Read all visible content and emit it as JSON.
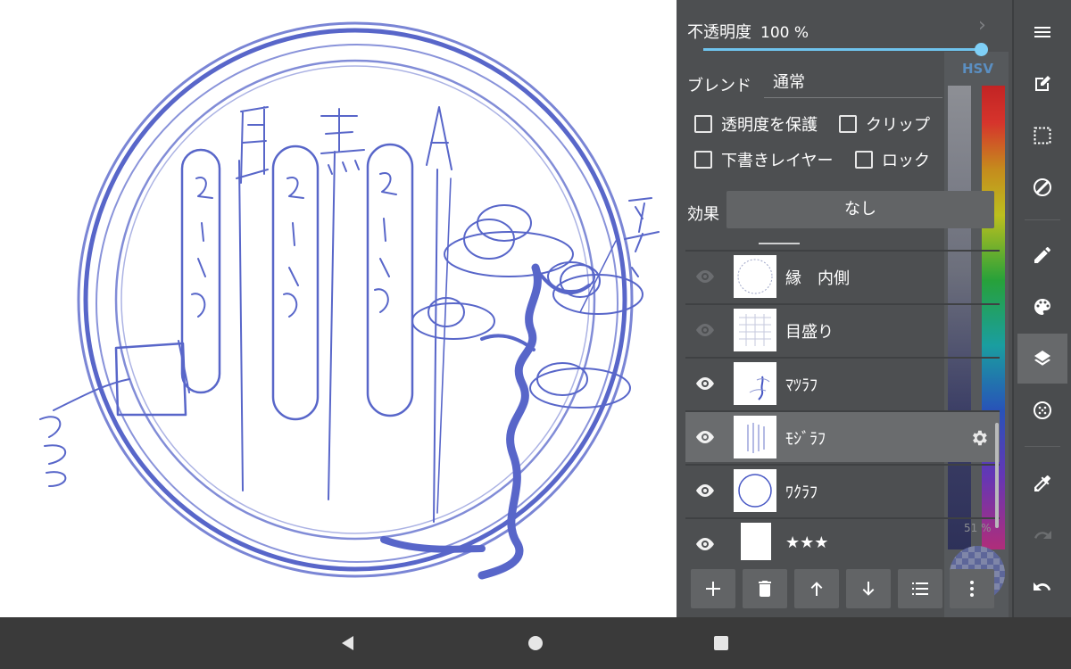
{
  "layer_panel": {
    "opacity_label": "不透明度",
    "opacity_value": "100 %",
    "opacity": 1.0,
    "blend_label": "ブレンド",
    "blend_value": "通常",
    "checkboxes": {
      "protect_alpha": "透明度を保護",
      "clipping": "クリップ",
      "draft_layer": "下書きレイヤー",
      "lock": "ロック"
    },
    "effect_label": "効果",
    "effect_value": "なし",
    "layers": [
      {
        "name": "縁　内側",
        "visible": false
      },
      {
        "name": "目盛り",
        "visible": false
      },
      {
        "name": "ﾏﾂﾗﾌ",
        "visible": true
      },
      {
        "name": "ﾓｼﾞﾗﾌ",
        "visible": true,
        "selected": true
      },
      {
        "name": "ﾜｸﾗﾌ",
        "visible": true
      },
      {
        "name": "★★★",
        "visible": true
      }
    ],
    "buttons": [
      "add-layer",
      "delete-layer",
      "move-up",
      "move-down",
      "layer-list",
      "more-options"
    ]
  },
  "color_picker": {
    "mode_label": "HSV",
    "opacity_label": "51 %"
  },
  "toolbar": [
    "menu",
    "edit",
    "selection",
    "transform",
    "pen",
    "palette",
    "layers",
    "material",
    "eyedropper",
    "redo",
    "undo"
  ],
  "colors": {
    "panel_bg": "#4d4f51",
    "accent": "#6fc4ee",
    "stroke": "#3e4ec0",
    "toolbar_bg": "#4a4c4e",
    "navbar_bg": "#3a3a3a"
  }
}
